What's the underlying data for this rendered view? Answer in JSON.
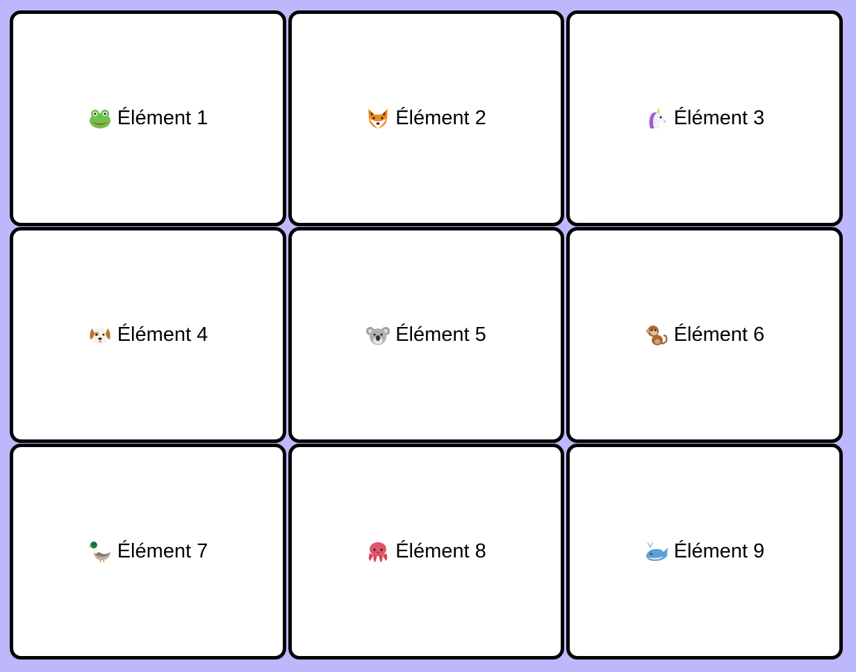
{
  "colors": {
    "background": "#bdb8fb",
    "card_background": "#ffffff",
    "card_border": "#000000",
    "text": "#000000"
  },
  "cards": [
    {
      "label": "Élément 1",
      "icon": "frog-icon"
    },
    {
      "label": "Élément 2",
      "icon": "fox-icon"
    },
    {
      "label": "Élément 3",
      "icon": "unicorn-icon"
    },
    {
      "label": "Élément 4",
      "icon": "dog-icon"
    },
    {
      "label": "Élément 5",
      "icon": "koala-icon"
    },
    {
      "label": "Élément 6",
      "icon": "monkey-icon"
    },
    {
      "label": "Élément 7",
      "icon": "duck-icon"
    },
    {
      "label": "Élément 8",
      "icon": "octopus-icon"
    },
    {
      "label": "Élément 9",
      "icon": "whale-icon"
    }
  ]
}
